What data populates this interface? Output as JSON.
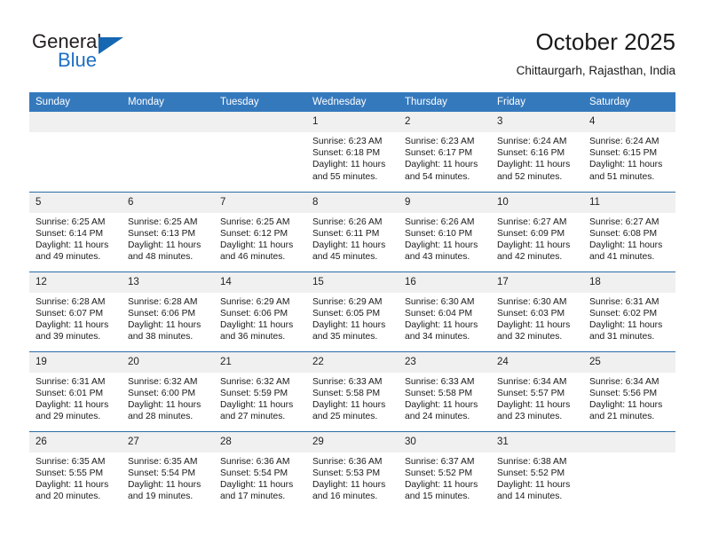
{
  "brand": {
    "name_top": "General",
    "name_bottom": "Blue",
    "triangle_color": "#1667b2",
    "blue_text_color": "#1f6fc4"
  },
  "header": {
    "title": "October 2025",
    "subtitle": "Chittaurgarh, Rajasthan, India"
  },
  "theme": {
    "header_row_bg": "#3579bd",
    "row_divider": "#2d6ca8",
    "daynum_bg": "#f0f0f0"
  },
  "weekday_headers": [
    "Sunday",
    "Monday",
    "Tuesday",
    "Wednesday",
    "Thursday",
    "Friday",
    "Saturday"
  ],
  "labels": {
    "sunrise_prefix": "Sunrise:",
    "sunset_prefix": "Sunset:",
    "daylight_prefix": "Daylight:"
  },
  "weeks": [
    [
      {
        "day": "",
        "empty": true,
        "sunrise": "",
        "sunset": "",
        "daylight_line1": "",
        "daylight_line2": ""
      },
      {
        "day": "",
        "empty": true,
        "sunrise": "",
        "sunset": "",
        "daylight_line1": "",
        "daylight_line2": ""
      },
      {
        "day": "",
        "empty": true,
        "sunrise": "",
        "sunset": "",
        "daylight_line1": "",
        "daylight_line2": ""
      },
      {
        "day": "1",
        "empty": false,
        "sunrise": "Sunrise: 6:23 AM",
        "sunset": "Sunset: 6:18 PM",
        "daylight_line1": "Daylight: 11 hours",
        "daylight_line2": "and 55 minutes."
      },
      {
        "day": "2",
        "empty": false,
        "sunrise": "Sunrise: 6:23 AM",
        "sunset": "Sunset: 6:17 PM",
        "daylight_line1": "Daylight: 11 hours",
        "daylight_line2": "and 54 minutes."
      },
      {
        "day": "3",
        "empty": false,
        "sunrise": "Sunrise: 6:24 AM",
        "sunset": "Sunset: 6:16 PM",
        "daylight_line1": "Daylight: 11 hours",
        "daylight_line2": "and 52 minutes."
      },
      {
        "day": "4",
        "empty": false,
        "sunrise": "Sunrise: 6:24 AM",
        "sunset": "Sunset: 6:15 PM",
        "daylight_line1": "Daylight: 11 hours",
        "daylight_line2": "and 51 minutes."
      }
    ],
    [
      {
        "day": "5",
        "empty": false,
        "sunrise": "Sunrise: 6:25 AM",
        "sunset": "Sunset: 6:14 PM",
        "daylight_line1": "Daylight: 11 hours",
        "daylight_line2": "and 49 minutes."
      },
      {
        "day": "6",
        "empty": false,
        "sunrise": "Sunrise: 6:25 AM",
        "sunset": "Sunset: 6:13 PM",
        "daylight_line1": "Daylight: 11 hours",
        "daylight_line2": "and 48 minutes."
      },
      {
        "day": "7",
        "empty": false,
        "sunrise": "Sunrise: 6:25 AM",
        "sunset": "Sunset: 6:12 PM",
        "daylight_line1": "Daylight: 11 hours",
        "daylight_line2": "and 46 minutes."
      },
      {
        "day": "8",
        "empty": false,
        "sunrise": "Sunrise: 6:26 AM",
        "sunset": "Sunset: 6:11 PM",
        "daylight_line1": "Daylight: 11 hours",
        "daylight_line2": "and 45 minutes."
      },
      {
        "day": "9",
        "empty": false,
        "sunrise": "Sunrise: 6:26 AM",
        "sunset": "Sunset: 6:10 PM",
        "daylight_line1": "Daylight: 11 hours",
        "daylight_line2": "and 43 minutes."
      },
      {
        "day": "10",
        "empty": false,
        "sunrise": "Sunrise: 6:27 AM",
        "sunset": "Sunset: 6:09 PM",
        "daylight_line1": "Daylight: 11 hours",
        "daylight_line2": "and 42 minutes."
      },
      {
        "day": "11",
        "empty": false,
        "sunrise": "Sunrise: 6:27 AM",
        "sunset": "Sunset: 6:08 PM",
        "daylight_line1": "Daylight: 11 hours",
        "daylight_line2": "and 41 minutes."
      }
    ],
    [
      {
        "day": "12",
        "empty": false,
        "sunrise": "Sunrise: 6:28 AM",
        "sunset": "Sunset: 6:07 PM",
        "daylight_line1": "Daylight: 11 hours",
        "daylight_line2": "and 39 minutes."
      },
      {
        "day": "13",
        "empty": false,
        "sunrise": "Sunrise: 6:28 AM",
        "sunset": "Sunset: 6:06 PM",
        "daylight_line1": "Daylight: 11 hours",
        "daylight_line2": "and 38 minutes."
      },
      {
        "day": "14",
        "empty": false,
        "sunrise": "Sunrise: 6:29 AM",
        "sunset": "Sunset: 6:06 PM",
        "daylight_line1": "Daylight: 11 hours",
        "daylight_line2": "and 36 minutes."
      },
      {
        "day": "15",
        "empty": false,
        "sunrise": "Sunrise: 6:29 AM",
        "sunset": "Sunset: 6:05 PM",
        "daylight_line1": "Daylight: 11 hours",
        "daylight_line2": "and 35 minutes."
      },
      {
        "day": "16",
        "empty": false,
        "sunrise": "Sunrise: 6:30 AM",
        "sunset": "Sunset: 6:04 PM",
        "daylight_line1": "Daylight: 11 hours",
        "daylight_line2": "and 34 minutes."
      },
      {
        "day": "17",
        "empty": false,
        "sunrise": "Sunrise: 6:30 AM",
        "sunset": "Sunset: 6:03 PM",
        "daylight_line1": "Daylight: 11 hours",
        "daylight_line2": "and 32 minutes."
      },
      {
        "day": "18",
        "empty": false,
        "sunrise": "Sunrise: 6:31 AM",
        "sunset": "Sunset: 6:02 PM",
        "daylight_line1": "Daylight: 11 hours",
        "daylight_line2": "and 31 minutes."
      }
    ],
    [
      {
        "day": "19",
        "empty": false,
        "sunrise": "Sunrise: 6:31 AM",
        "sunset": "Sunset: 6:01 PM",
        "daylight_line1": "Daylight: 11 hours",
        "daylight_line2": "and 29 minutes."
      },
      {
        "day": "20",
        "empty": false,
        "sunrise": "Sunrise: 6:32 AM",
        "sunset": "Sunset: 6:00 PM",
        "daylight_line1": "Daylight: 11 hours",
        "daylight_line2": "and 28 minutes."
      },
      {
        "day": "21",
        "empty": false,
        "sunrise": "Sunrise: 6:32 AM",
        "sunset": "Sunset: 5:59 PM",
        "daylight_line1": "Daylight: 11 hours",
        "daylight_line2": "and 27 minutes."
      },
      {
        "day": "22",
        "empty": false,
        "sunrise": "Sunrise: 6:33 AM",
        "sunset": "Sunset: 5:58 PM",
        "daylight_line1": "Daylight: 11 hours",
        "daylight_line2": "and 25 minutes."
      },
      {
        "day": "23",
        "empty": false,
        "sunrise": "Sunrise: 6:33 AM",
        "sunset": "Sunset: 5:58 PM",
        "daylight_line1": "Daylight: 11 hours",
        "daylight_line2": "and 24 minutes."
      },
      {
        "day": "24",
        "empty": false,
        "sunrise": "Sunrise: 6:34 AM",
        "sunset": "Sunset: 5:57 PM",
        "daylight_line1": "Daylight: 11 hours",
        "daylight_line2": "and 23 minutes."
      },
      {
        "day": "25",
        "empty": false,
        "sunrise": "Sunrise: 6:34 AM",
        "sunset": "Sunset: 5:56 PM",
        "daylight_line1": "Daylight: 11 hours",
        "daylight_line2": "and 21 minutes."
      }
    ],
    [
      {
        "day": "26",
        "empty": false,
        "sunrise": "Sunrise: 6:35 AM",
        "sunset": "Sunset: 5:55 PM",
        "daylight_line1": "Daylight: 11 hours",
        "daylight_line2": "and 20 minutes."
      },
      {
        "day": "27",
        "empty": false,
        "sunrise": "Sunrise: 6:35 AM",
        "sunset": "Sunset: 5:54 PM",
        "daylight_line1": "Daylight: 11 hours",
        "daylight_line2": "and 19 minutes."
      },
      {
        "day": "28",
        "empty": false,
        "sunrise": "Sunrise: 6:36 AM",
        "sunset": "Sunset: 5:54 PM",
        "daylight_line1": "Daylight: 11 hours",
        "daylight_line2": "and 17 minutes."
      },
      {
        "day": "29",
        "empty": false,
        "sunrise": "Sunrise: 6:36 AM",
        "sunset": "Sunset: 5:53 PM",
        "daylight_line1": "Daylight: 11 hours",
        "daylight_line2": "and 16 minutes."
      },
      {
        "day": "30",
        "empty": false,
        "sunrise": "Sunrise: 6:37 AM",
        "sunset": "Sunset: 5:52 PM",
        "daylight_line1": "Daylight: 11 hours",
        "daylight_line2": "and 15 minutes."
      },
      {
        "day": "31",
        "empty": false,
        "sunrise": "Sunrise: 6:38 AM",
        "sunset": "Sunset: 5:52 PM",
        "daylight_line1": "Daylight: 11 hours",
        "daylight_line2": "and 14 minutes."
      },
      {
        "day": "",
        "empty": true,
        "sunrise": "",
        "sunset": "",
        "daylight_line1": "",
        "daylight_line2": ""
      }
    ]
  ]
}
